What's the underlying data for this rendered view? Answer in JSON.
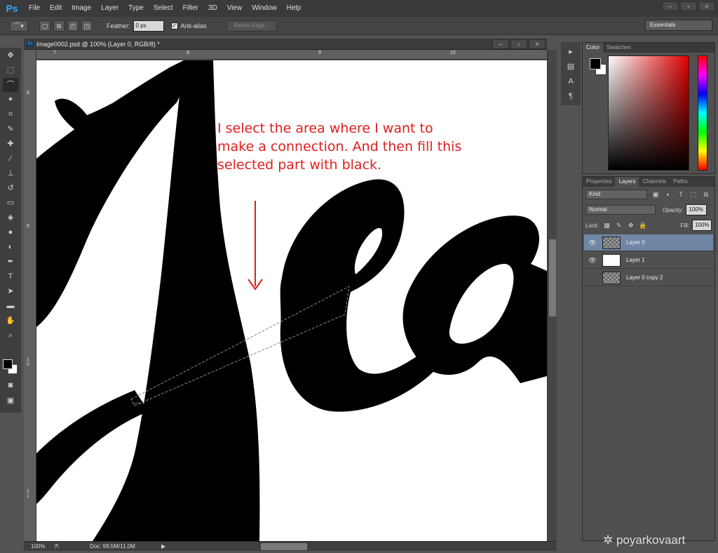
{
  "app": {
    "logo": "Ps"
  },
  "menu": [
    "File",
    "Edit",
    "Image",
    "Layer",
    "Type",
    "Select",
    "Filter",
    "3D",
    "View",
    "Window",
    "Help"
  ],
  "window_controls": [
    "–",
    "▫",
    "×"
  ],
  "options_bar": {
    "feather_label": "Feather:",
    "feather_value": "0 px",
    "antialias_label": "Anti-alias",
    "antialias_checked": "✓",
    "refine_edge": "Refine Edge...",
    "workspace": "Essentials"
  },
  "document": {
    "title": "Image0002.psd @ 100% (Layer 0, RGB/8) *",
    "icon": "Ps",
    "ruler_top": [
      "7",
      "8",
      "9",
      "10"
    ],
    "ruler_left": [
      "8",
      "9",
      "1 0",
      "1 1"
    ],
    "zoom": "100%",
    "doc_info": "Doc: 99,5M/11,0M",
    "annotation": [
      "I select the area where I want to",
      "make a connection. And then fill this",
      "selected part with black."
    ],
    "annotation_color": "#e01e1e"
  },
  "color_panel": {
    "tabs": [
      "Color",
      "Swatches"
    ]
  },
  "layers_panel": {
    "tabs": [
      "Properties",
      "Layers",
      "Channels",
      "Paths"
    ],
    "kind_filter": "Kind",
    "blend_mode": "Normal",
    "opacity_label": "Opacity:",
    "opacity_value": "100%",
    "lock_label": "Lock:",
    "fill_label": "Fill:",
    "fill_value": "100%",
    "layers": [
      {
        "name": "Layer 0",
        "visible": "👁",
        "active": true
      },
      {
        "name": "Layer 1",
        "visible": "👁",
        "active": false
      },
      {
        "name": "Layer 0 copy 2",
        "visible": "",
        "active": false
      }
    ]
  },
  "watermark": "poyarkovaart"
}
